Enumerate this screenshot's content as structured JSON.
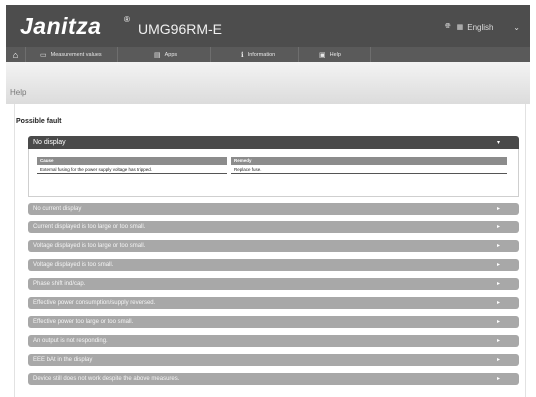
{
  "header": {
    "logo": "Janitza",
    "logo_mark": "®",
    "device": "UMG96RM-E",
    "language": "English",
    "globe_icon": "globe-icon",
    "flag_icon": "flag-icon"
  },
  "nav": {
    "items": [
      {
        "label": "Measurement values",
        "icon": "chart-icon"
      },
      {
        "label": "Apps",
        "icon": "apps-icon"
      },
      {
        "label": "Information",
        "icon": "info-icon"
      },
      {
        "label": "Help",
        "icon": "help-icon"
      }
    ]
  },
  "page": {
    "title": "Help",
    "section_heading": "Possible fault"
  },
  "faults": {
    "open": {
      "label": "No display",
      "cause_header": "Cause",
      "cause_text": "External fusing for the power supply voltage has tripped.",
      "remedy_header": "Remedy",
      "remedy_text": "Replace fuse."
    },
    "items": [
      "No current display",
      "Current displayed is too large or too small.",
      "Voltage displayed is too large or too small.",
      "Voltage displayed is too small.",
      "Phase shift ind/cap.",
      "Effective power consumption/supply reversed.",
      "Effective power too large or too small.",
      "An output is not responding.",
      "EEE bAt in the display",
      "Device still does not work despite the above measures."
    ]
  },
  "colors": {
    "header_bg": "#4d4d4d",
    "accordion_open": "#4a4a4a",
    "accordion_closed": "#a8a8a8"
  }
}
